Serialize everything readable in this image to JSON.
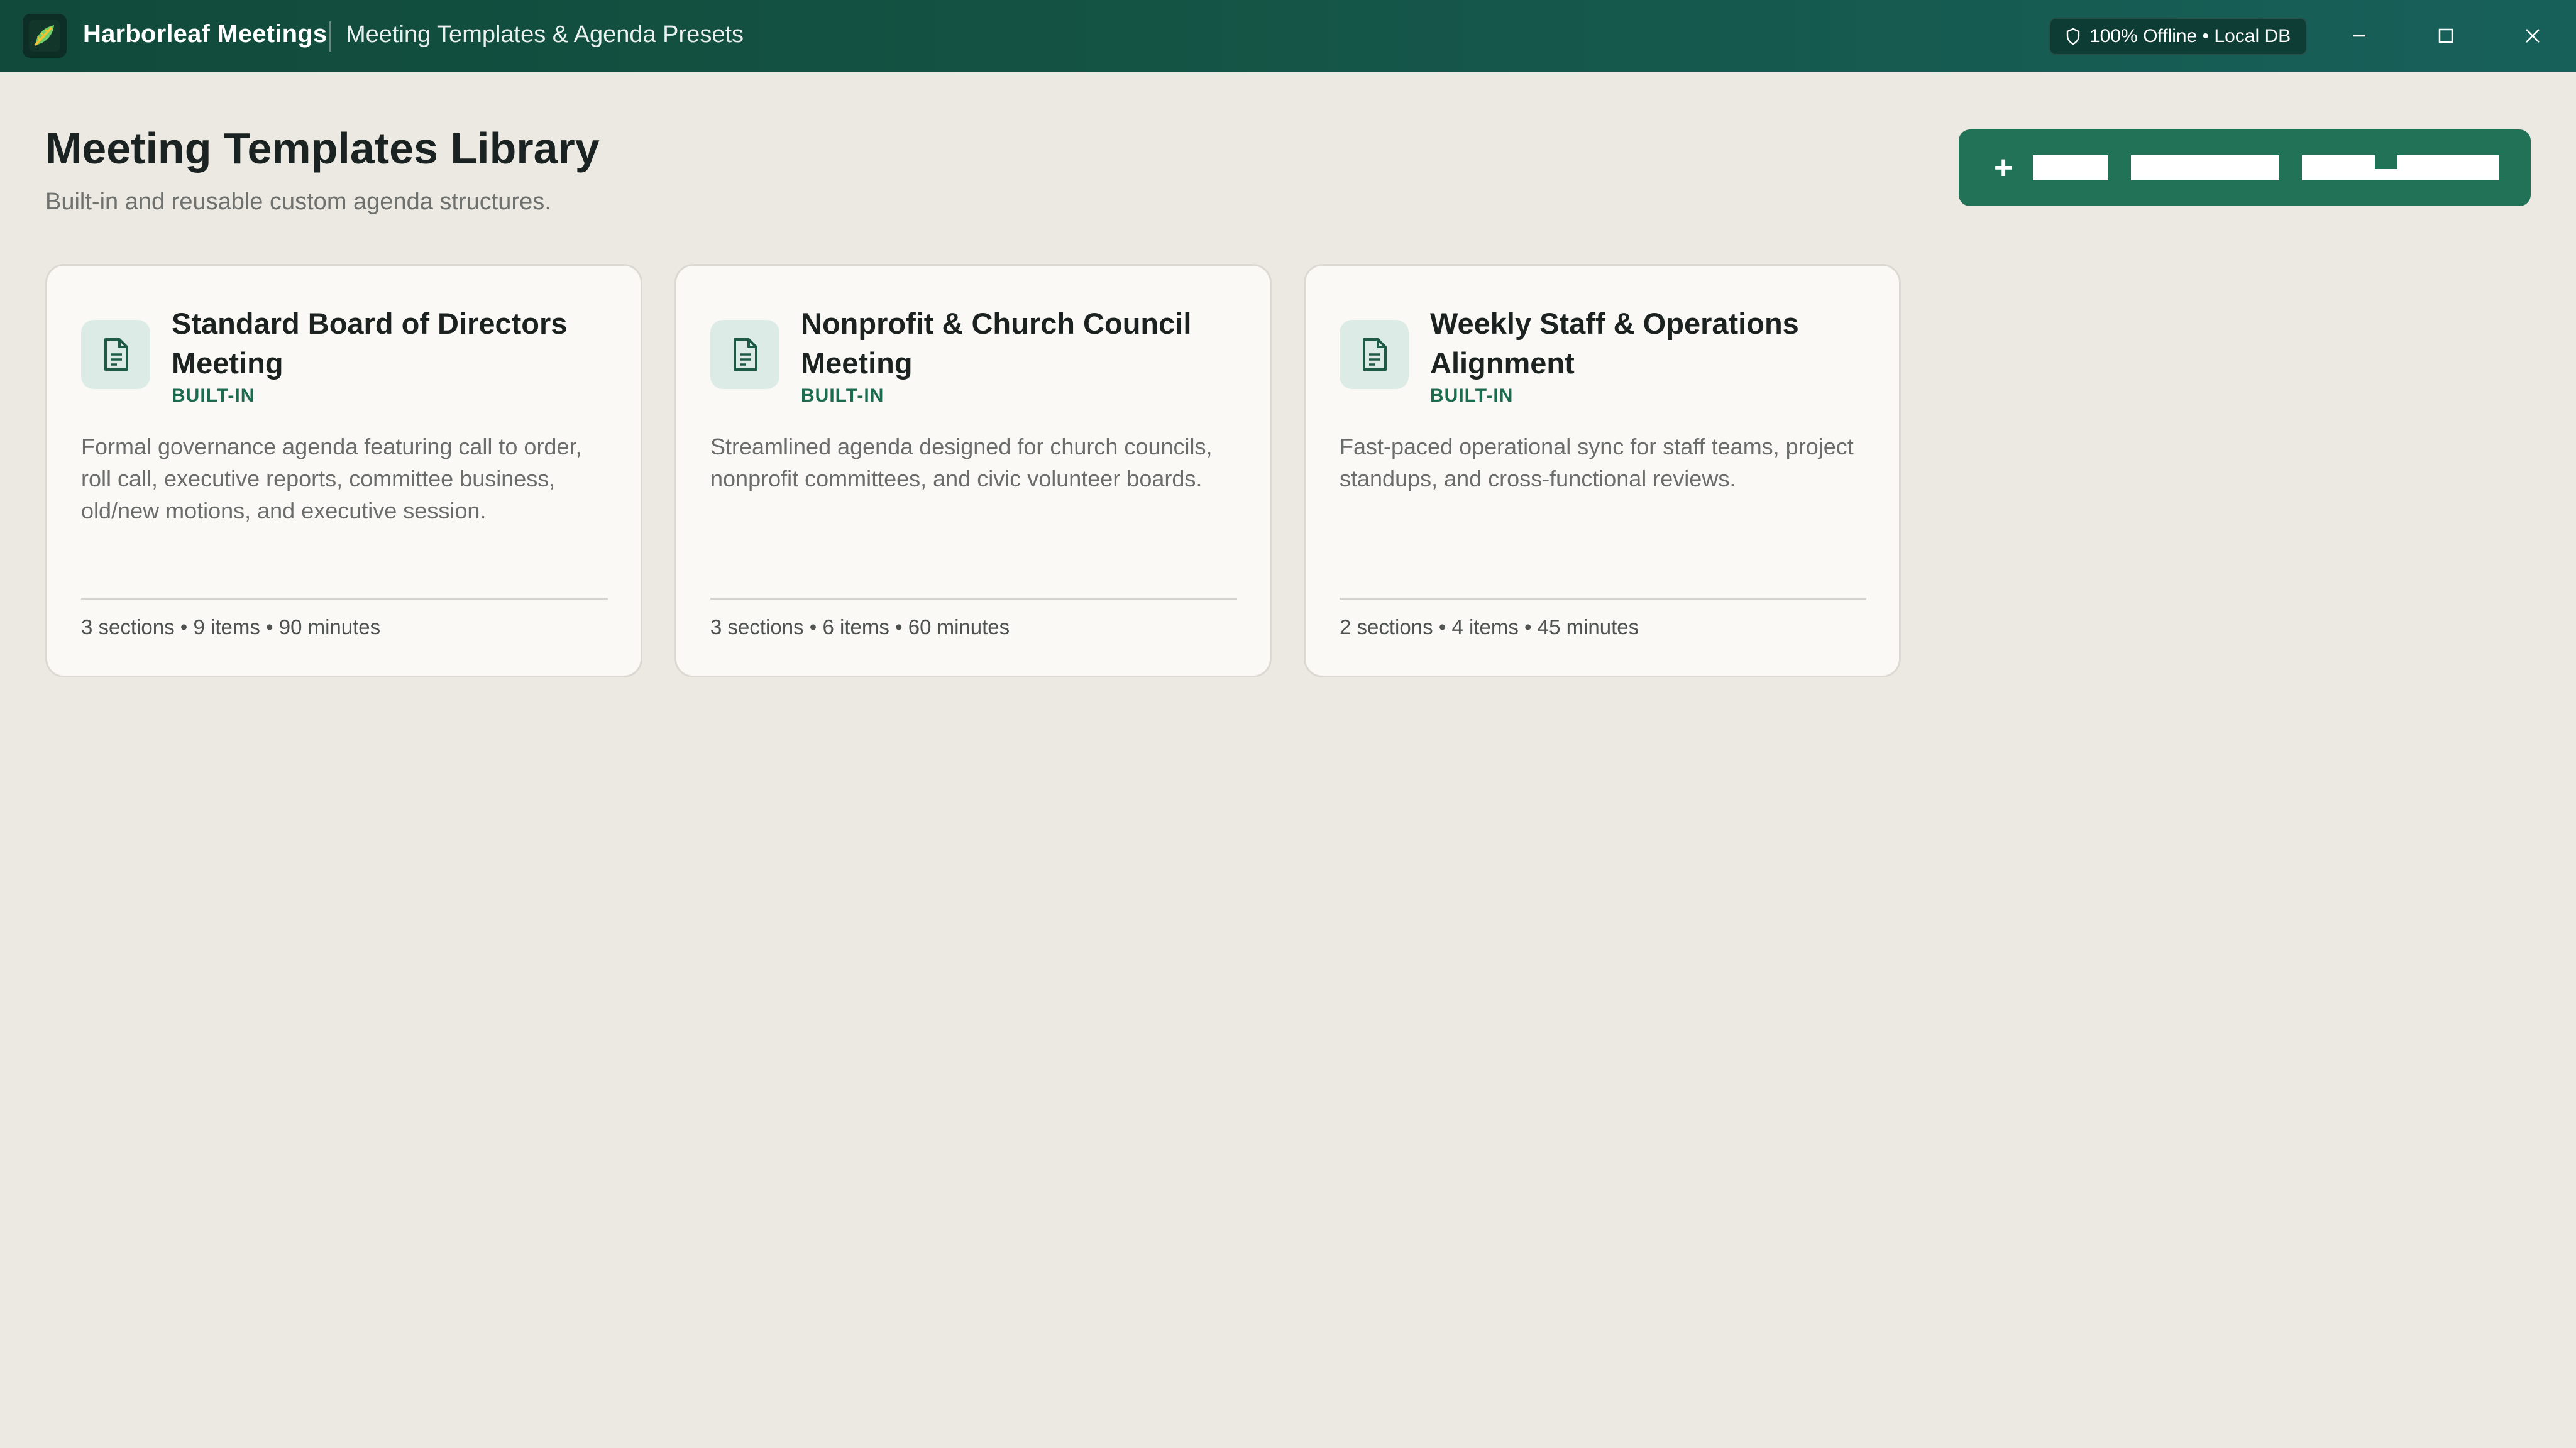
{
  "titlebar": {
    "app_name": "Harborleaf Meetings",
    "window_title": "Meeting Templates & Agenda Presets",
    "status_badge": "100% Offline • Local DB",
    "controls": [
      "minimize",
      "maximize",
      "close"
    ]
  },
  "header": {
    "title": "Meeting Templates Library",
    "subtitle": "Built-in and reusable custom agenda structures.",
    "primary_button_icon": "+"
  },
  "templates": [
    {
      "title": "Standard Board of Directors Meeting",
      "badge": "BUILT-IN",
      "description": "Formal governance agenda featuring call to order, roll call, executive reports, committee business, old/new motions, and executive session.",
      "meta": "3 sections • 9 items • 90 minutes",
      "icon": "document-icon"
    },
    {
      "title": "Nonprofit & Church Council Meeting",
      "badge": "BUILT-IN",
      "description": "Streamlined agenda designed for church councils, nonprofit committees, and civic volunteer boards.",
      "meta": "3 sections • 6 items • 60 minutes",
      "icon": "document-icon"
    },
    {
      "title": "Weekly Staff & Operations Alignment",
      "badge": "BUILT-IN",
      "description": "Fast-paced operational sync for staff teams, project standups, and cross-functional reviews.",
      "meta": "2 sections • 4 items • 45 minutes",
      "icon": "document-icon"
    }
  ],
  "colors": {
    "titlebar": "#145445",
    "accent": "#227257",
    "badge": "#1b6b4f",
    "background": "#ece9e3",
    "card": "#faf9f6"
  }
}
